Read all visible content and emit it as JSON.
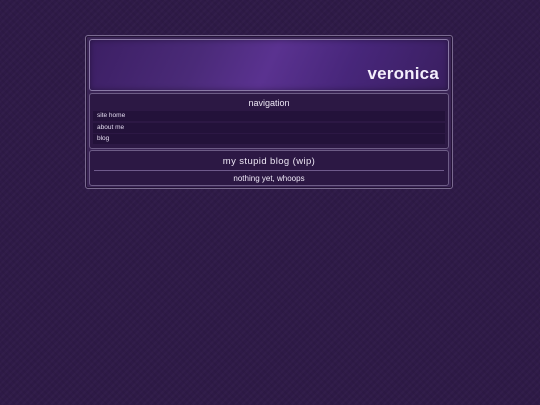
{
  "header": {
    "site_title": "veronica"
  },
  "navigation": {
    "heading": "navigation",
    "items": [
      {
        "label": "site home"
      },
      {
        "label": "about me"
      },
      {
        "label": "blog"
      }
    ]
  },
  "blog": {
    "heading": "my stupid blog (wip)",
    "body": "nothing yet, whoops"
  },
  "colors": {
    "page_background": "#2e1a47",
    "header_accent": "#5a3290",
    "panel_background": "#2c1844",
    "text": "#ece6f4"
  }
}
